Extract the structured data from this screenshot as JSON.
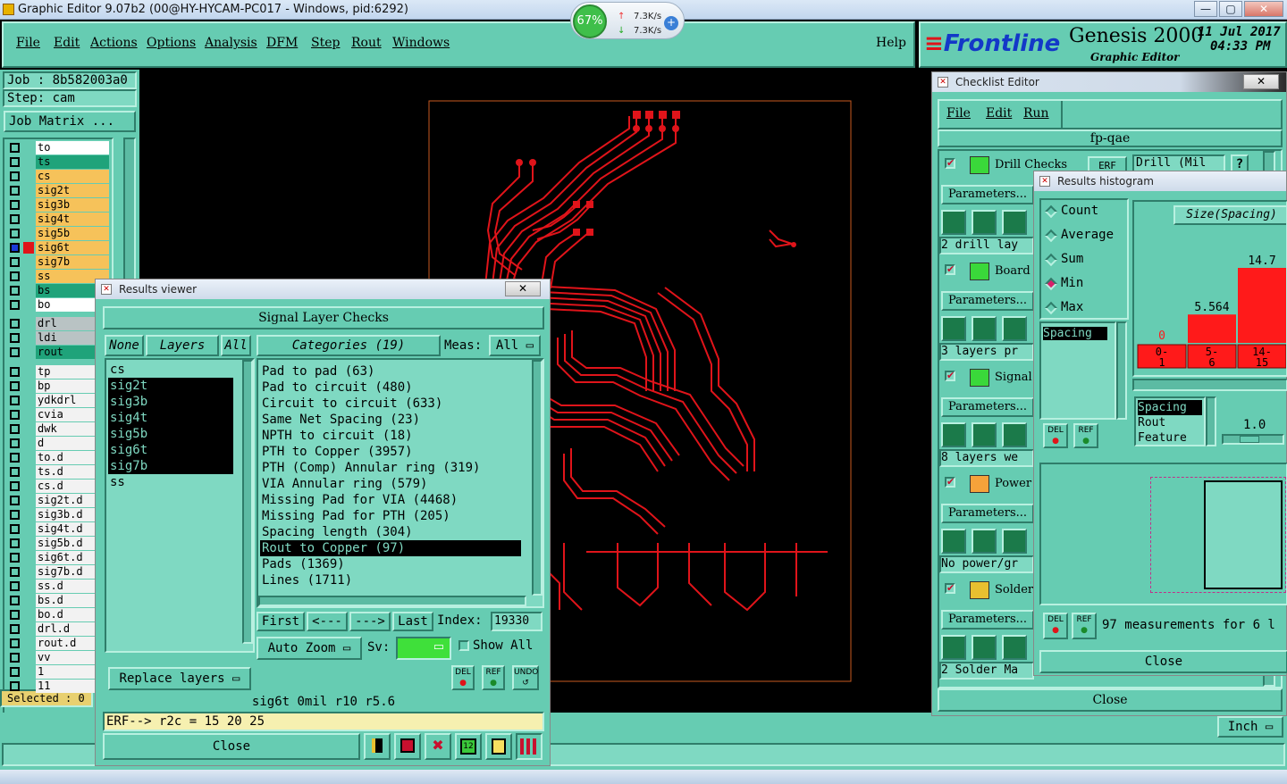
{
  "window": {
    "title": "Graphic Editor 9.07b2 (00@HY-HYCAM-PC017 - Windows, pid:6292)",
    "net_percent": "67%",
    "net_up": "7.3K/s",
    "net_down": "7.3K/s",
    "minimize": "—",
    "maximize": "▢",
    "close": "✕"
  },
  "menu": [
    "File",
    "Edit",
    "Actions",
    "Options",
    "Analysis",
    "DFM",
    "Step",
    "Rout",
    "Windows"
  ],
  "help": "Help",
  "brand": {
    "logo": "Frontline",
    "product": "Genesis 2000",
    "subtitle": "Graphic Editor",
    "date": "11 Jul 2017",
    "time": "04:33 PM"
  },
  "job": {
    "job_line": "Job : 8b582003a0",
    "step_line": "Step: cam",
    "matrix_button": "Job Matrix ...",
    "selected": "Selected : 0"
  },
  "layers_group1": [
    {
      "name": "to",
      "color": "#ffffff"
    },
    {
      "name": "ts",
      "color": "#1fa37a"
    },
    {
      "name": "cs",
      "color": "#f6c25a"
    },
    {
      "name": "sig2t",
      "color": "#f6c25a"
    },
    {
      "name": "sig3b",
      "color": "#f6c25a"
    },
    {
      "name": "sig4t",
      "color": "#f6c25a"
    },
    {
      "name": "sig5b",
      "color": "#f6c25a"
    },
    {
      "name": "sig6t",
      "color": "#f6c25a"
    },
    {
      "name": "sig7b",
      "color": "#f6c25a"
    },
    {
      "name": "ss",
      "color": "#f6c25a"
    },
    {
      "name": "bs",
      "color": "#1fa37a"
    },
    {
      "name": "bo",
      "color": "#ffffff"
    }
  ],
  "layers_group2": [
    {
      "name": "drl",
      "color": "#b9c3c4"
    },
    {
      "name": "ldi",
      "color": "#b9c3c4"
    },
    {
      "name": "rout",
      "color": "#1fa37a"
    }
  ],
  "layers_group3": [
    "tp",
    "bp",
    "ydkdrl",
    "cvia",
    "dwk",
    "d",
    "to.d",
    "ts.d",
    "cs.d",
    "sig2t.d",
    "sig3b.d",
    "sig4t.d",
    "sig5b.d",
    "sig6t.d",
    "sig7b.d",
    "ss.d",
    "bs.d",
    "bo.d",
    "drl.d",
    "rout.d",
    "vv",
    "1",
    "11"
  ],
  "results_viewer": {
    "title": "Results viewer",
    "header": "Signal Layer Checks",
    "none_btn": "None",
    "layers_btn": "Layers",
    "all_btn": "All",
    "layers": [
      {
        "name": "cs",
        "selected": false
      },
      {
        "name": "sig2t",
        "selected": true
      },
      {
        "name": "sig3b",
        "selected": true
      },
      {
        "name": "sig4t",
        "selected": true
      },
      {
        "name": "sig5b",
        "selected": true
      },
      {
        "name": "sig6t",
        "selected": true
      },
      {
        "name": "sig7b",
        "selected": true
      },
      {
        "name": "ss",
        "selected": false
      }
    ],
    "categories_btn": "Categories (19)",
    "meas_label": "Meas:",
    "meas_value": "All",
    "categories": [
      {
        "name": "Pad to pad (63)",
        "selected": false
      },
      {
        "name": "Pad to circuit (480)",
        "selected": false
      },
      {
        "name": "Circuit to circuit (633)",
        "selected": false
      },
      {
        "name": "Same Net Spacing (23)",
        "selected": false
      },
      {
        "name": "NPTH to circuit (18)",
        "selected": false
      },
      {
        "name": "PTH to Copper (3957)",
        "selected": false
      },
      {
        "name": "PTH (Comp) Annular ring (319)",
        "selected": false
      },
      {
        "name": "VIA Annular ring (579)",
        "selected": false
      },
      {
        "name": "Missing Pad for VIA (4468)",
        "selected": false
      },
      {
        "name": "Missing Pad for PTH (205)",
        "selected": false
      },
      {
        "name": "Spacing length (304)",
        "selected": false
      },
      {
        "name": "Rout to Copper (97)",
        "selected": true
      },
      {
        "name": "Pads (1369)",
        "selected": false
      },
      {
        "name": "Lines (1711)",
        "selected": false
      }
    ],
    "first": "First",
    "prev": "<---",
    "next": "--->",
    "last": "Last",
    "index_label": "Index:",
    "index_value": "19330",
    "auto_zoom": "Auto Zoom",
    "sv_label": "Sv:",
    "show_all": "Show All",
    "replace_layers": "Replace layers",
    "status_line": "sig6t 0mil r10 r5.6",
    "erf_line": "ERF--> r2c = 15 20 25",
    "close": "Close",
    "del": "DEL",
    "ref": "REF",
    "undo": "UNDO"
  },
  "checklist": {
    "title": "Checklist Editor",
    "menu": [
      "File",
      "Edit",
      "Run"
    ],
    "name": "fp-qae",
    "items": [
      {
        "label": "Drill Checks",
        "erf": "ERF",
        "field": "Drill (Mil",
        "summary": "2 drill lay"
      },
      {
        "label": "Board",
        "summary": "3 layers pr"
      },
      {
        "label": "Signal",
        "summary": "8 layers we"
      },
      {
        "label": "Power",
        "summary": "No power/gr"
      },
      {
        "label": "Solder",
        "summary": "2 Solder Ma"
      }
    ],
    "parameters": "Parameters...",
    "close": "Close"
  },
  "histogram": {
    "title": "Results histogram",
    "options": [
      {
        "label": "Count",
        "selected": false
      },
      {
        "label": "Average",
        "selected": false
      },
      {
        "label": "Sum",
        "selected": false
      },
      {
        "label": "Min",
        "selected": true
      },
      {
        "label": "Max",
        "selected": false
      }
    ],
    "list_item": "Spacing",
    "chart_title": "Size(Spacing)",
    "feature_list": [
      "Spacing",
      "Rout",
      "Feature"
    ],
    "scale_value": "1.0",
    "measurements": "97 measurements for 6 l",
    "close": "Close",
    "del": "DEL",
    "ref": "REF"
  },
  "chart_data": {
    "type": "bar",
    "title": "Size(Spacing)",
    "categories": [
      "0-1",
      "5-6",
      "14-15"
    ],
    "values": [
      0,
      5.564,
      14.7
    ],
    "value_labels": [
      "0",
      "5.564",
      "14.7"
    ],
    "colors": {
      "bar": "#ff1a1a",
      "label": "#ff1a1a"
    }
  },
  "units": "Inch",
  "colors": {
    "panel": "#66ccb2",
    "highlight": "#b8f0e0",
    "shadow": "#2f7d6a",
    "trace": "#e0141a"
  }
}
